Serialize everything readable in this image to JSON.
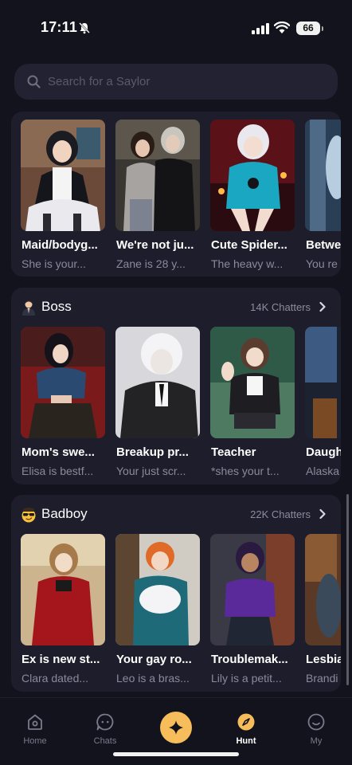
{
  "status_bar": {
    "time": "17:11",
    "battery": "66"
  },
  "search": {
    "placeholder": "Search for a Saylor"
  },
  "sections": [
    {
      "title": "",
      "cards": [
        {
          "title": "Maid/bodyg...",
          "subtitle": "She is your..."
        },
        {
          "title": "We're not ju...",
          "subtitle": "Zane is 28 y..."
        },
        {
          "title": "Cute Spider...",
          "subtitle": "The heavy w..."
        },
        {
          "title": "Betwe",
          "subtitle": "You re"
        }
      ]
    },
    {
      "emoji": "man-in-suit-icon",
      "title": "Boss",
      "count": "14K Chatters",
      "cards": [
        {
          "title": "Mom's swe...",
          "subtitle": "Elisa is bestf..."
        },
        {
          "title": "Breakup pr...",
          "subtitle": "Your just scr..."
        },
        {
          "title": "Teacher",
          "subtitle": "*shes your t..."
        },
        {
          "title": "Daugh",
          "subtitle": "Alaska"
        }
      ]
    },
    {
      "emoji": "smirk-sunglasses-icon",
      "title": "Badboy",
      "count": "22K Chatters",
      "cards": [
        {
          "title": "Ex is new st...",
          "subtitle": "Clara dated..."
        },
        {
          "title": "Your gay ro...",
          "subtitle": "Leo is a bras..."
        },
        {
          "title": "Troublemak...",
          "subtitle": "Lily is a petit..."
        },
        {
          "title": "Lesbia",
          "subtitle": "Brandi"
        }
      ]
    }
  ],
  "nav": {
    "home": "Home",
    "chats": "Chats",
    "hunt": "Hunt",
    "my": "My"
  },
  "colors": {
    "background": "#13131d",
    "card_bg": "#1d1d2b",
    "accent": "#f7bd5a"
  }
}
